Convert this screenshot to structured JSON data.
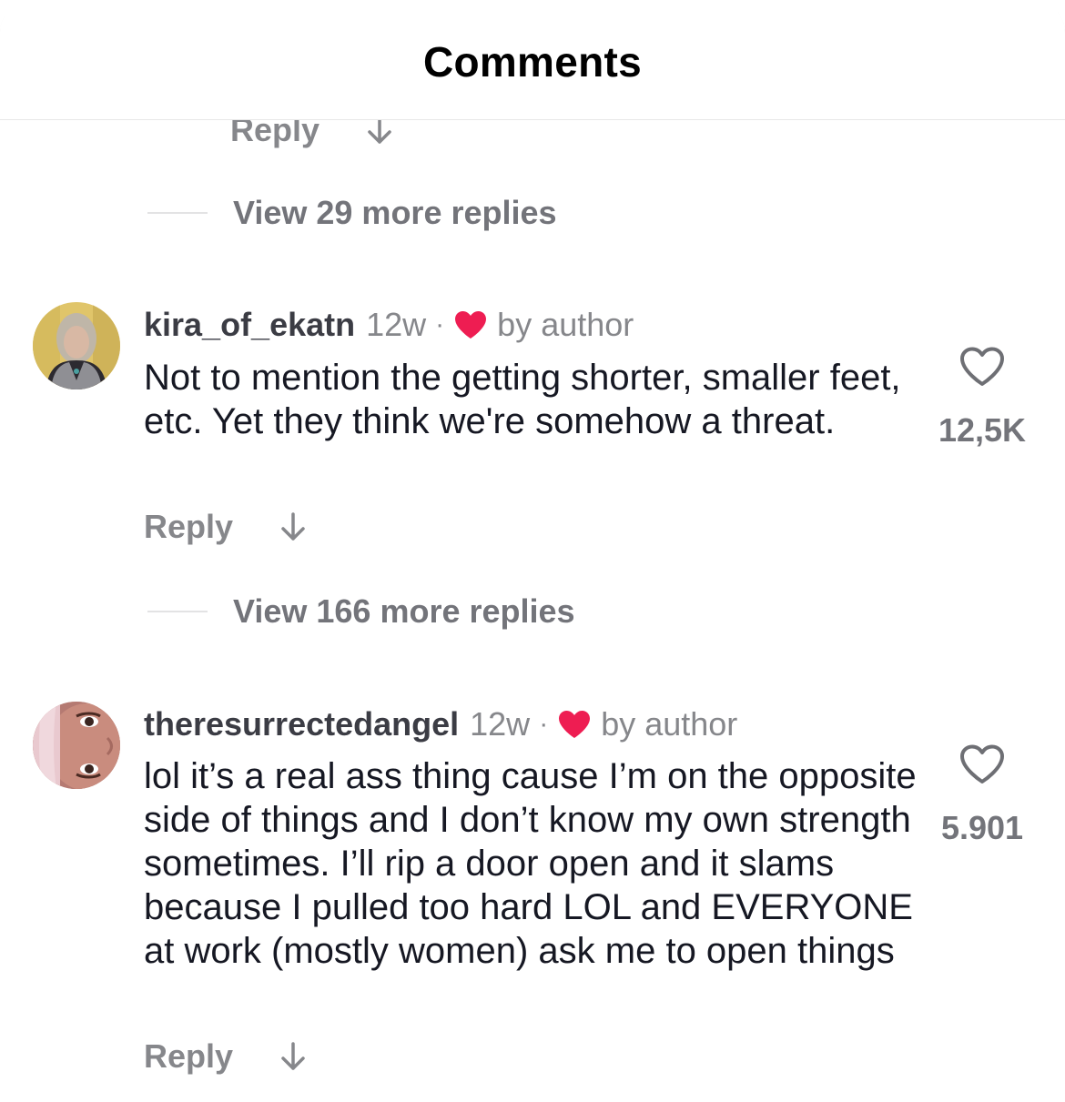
{
  "header": {
    "title": "Comments"
  },
  "top_fragment": {
    "reply_label": "Reply",
    "view_more": "View 29 more replies"
  },
  "comments": [
    {
      "username": "kira_of_ekatn",
      "age": "12w",
      "separator": "·",
      "author_badge": "by author",
      "text": "Not to mention the getting shorter, smaller feet, etc.  Yet they think we're somehow a threat.",
      "like_count": "12,5K",
      "reply_label": "Reply",
      "view_more": "View 166 more replies"
    },
    {
      "username": "theresurrectedangel",
      "age": "12w",
      "separator": "·",
      "author_badge": "by author",
      "text": "lol it’s a real ass thing cause I’m on the opposite side of things and I don’t know my own strength sometimes. I’ll rip a door open and it slams because I pulled too hard LOL and EVERYONE at work (mostly women) ask me to open things",
      "like_count": "5.901",
      "reply_label": "Reply"
    }
  ],
  "icons": {
    "like": "heart-outline-icon",
    "liked_by_author": "heart-filled-icon",
    "expand": "arrow-down-icon"
  },
  "colors": {
    "author_heart": "#ee1d52",
    "muted_text": "#86878b",
    "primary_text": "#161823"
  }
}
